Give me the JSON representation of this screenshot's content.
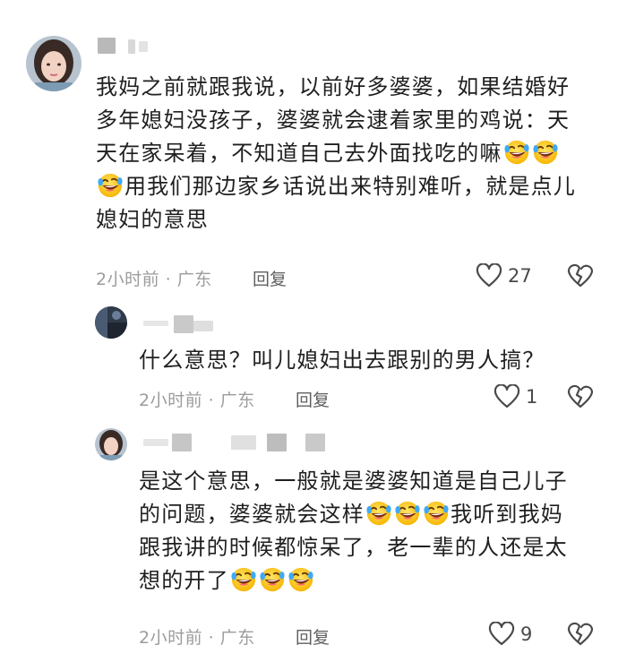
{
  "comments": [
    {
      "text_line1": "我妈之前就跟我说，以前好多婆婆，如果结婚好",
      "text_line2": "多年媳妇没孩子，婆婆就会逮着家里的鸡说：天",
      "text_line3": "天在家呆着，不知道自己去外面找吃的嘛",
      "text_line4": "用我们那边家乡话说出来特别难听，就是点儿",
      "text_line5": "媳妇的意思",
      "time": "2小时前 · 广东",
      "reply_label": "回复",
      "likes": "27"
    },
    {
      "text_line1": "什么意思？叫儿媳妇出去跟别的男人搞？",
      "time": "2小时前 · 广东",
      "reply_label": "回复",
      "likes": "1"
    },
    {
      "text_line1": "是这个意思，一般就是婆婆知道是自己儿子",
      "text_line2a": "的问题，婆婆就会这样",
      "text_line2b": "我听到我妈",
      "text_line3": "跟我讲的时候都惊呆了，老一辈的人还是太",
      "text_line4": "想的开了",
      "time": "2小时前 · 广东",
      "reply_label": "回复",
      "likes": "9"
    }
  ],
  "icons": {
    "like": "heart-outline-icon",
    "dislike": "broken-heart-icon",
    "emoji": "rofl-emoji-icon"
  },
  "colors": {
    "text": "#1f1f1f",
    "meta": "#9c9c9c",
    "reply": "#5f5f5f"
  }
}
